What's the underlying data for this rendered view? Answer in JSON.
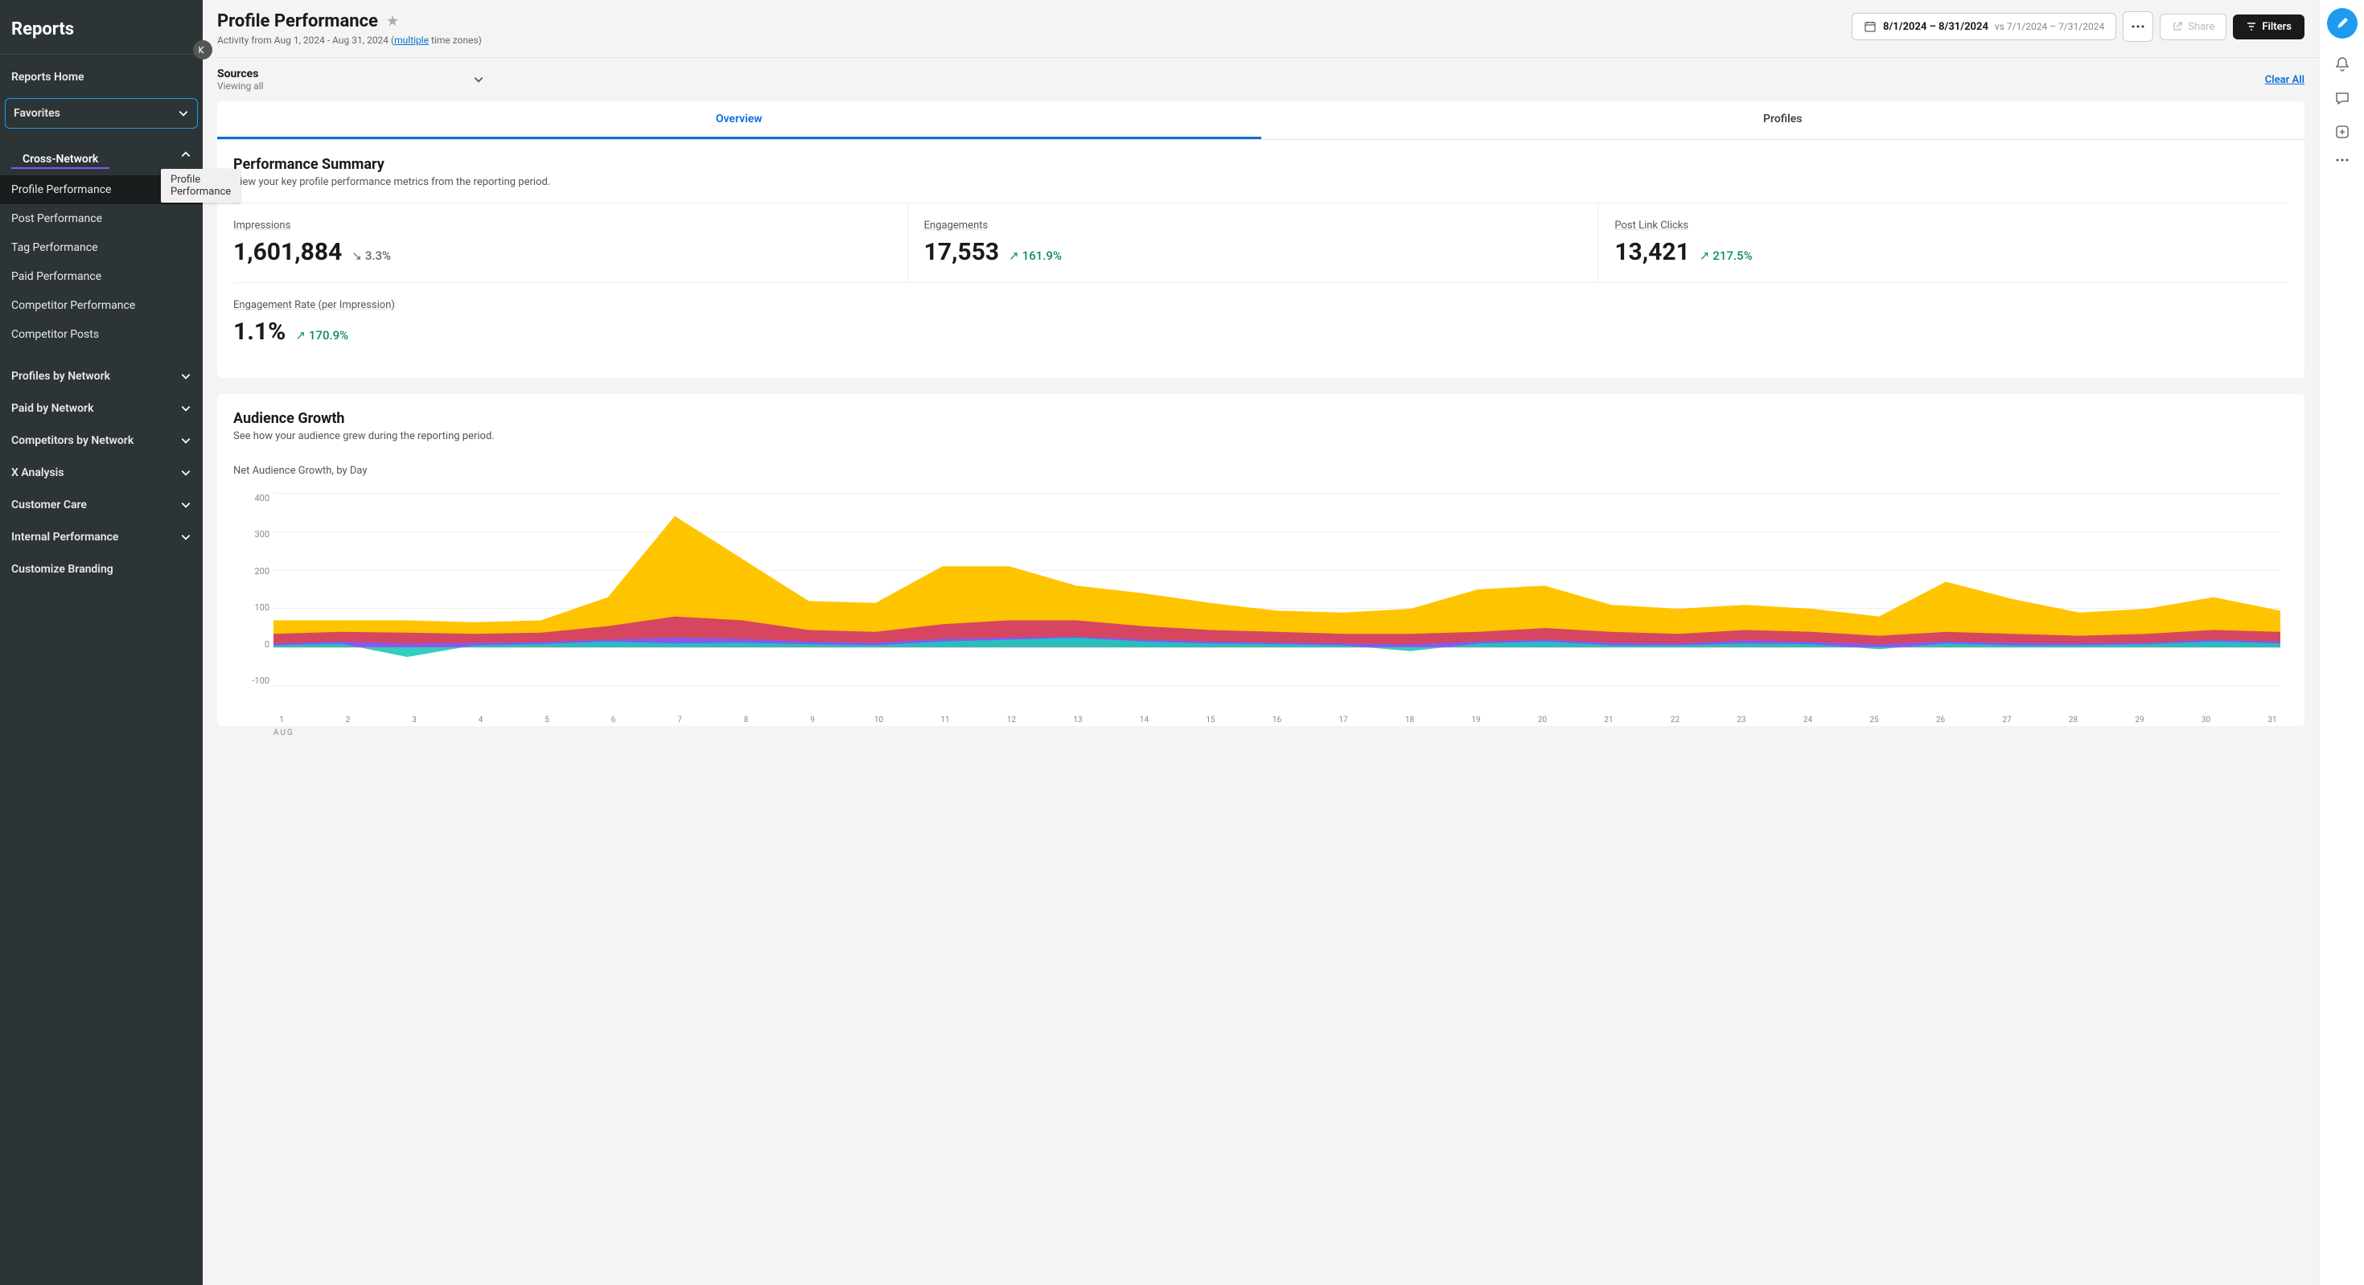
{
  "sidebar": {
    "title": "Reports",
    "home": "Reports Home",
    "favorites": "Favorites",
    "cross_network": "Cross-Network",
    "cn_items": [
      "Profile Performance",
      "Post Performance",
      "Tag Performance",
      "Paid Performance",
      "Competitor Performance",
      "Competitor Posts"
    ],
    "sections": [
      "Profiles by Network",
      "Paid by Network",
      "Competitors by Network",
      "X Analysis",
      "Customer Care",
      "Internal Performance"
    ],
    "customize": "Customize Branding",
    "tooltip": "Profile Performance"
  },
  "header": {
    "title": "Profile Performance",
    "subtitle_prefix": "Activity from Aug 1, 2024 - Aug 31, 2024 (",
    "subtitle_link": "multiple",
    "subtitle_suffix": " time zones)",
    "date_range": "8/1/2024 – 8/31/2024",
    "vs": "vs 7/1/2024 – 7/31/2024",
    "share": "Share",
    "filters": "Filters"
  },
  "sources": {
    "label": "Sources",
    "viewing": "Viewing all",
    "clear": "Clear All"
  },
  "tabs": {
    "overview": "Overview",
    "profiles": "Profiles"
  },
  "summary": {
    "title": "Performance Summary",
    "desc": "View your key profile performance metrics from the reporting period.",
    "metrics": [
      {
        "label": "Impressions",
        "value": "1,601,884",
        "delta": "3.3%",
        "dir": "down"
      },
      {
        "label": "Engagements",
        "value": "17,553",
        "delta": "161.9%",
        "dir": "up"
      },
      {
        "label": "Post Link Clicks",
        "value": "13,421",
        "delta": "217.5%",
        "dir": "up"
      }
    ],
    "metric2": {
      "label": "Engagement Rate (per Impression)",
      "value": "1.1%",
      "delta": "170.9%",
      "dir": "up"
    }
  },
  "growth": {
    "title": "Audience Growth",
    "desc": "See how your audience grew during the reporting period.",
    "chart_title": "Net Audience Growth, by Day",
    "month": "AUG"
  },
  "chart_data": {
    "type": "area",
    "title": "Net Audience Growth, by Day",
    "xlabel": "AUG",
    "ylabel": "",
    "ylim": [
      -100,
      400
    ],
    "yticks": [
      400,
      300,
      200,
      100,
      0,
      -100
    ],
    "categories": [
      1,
      2,
      3,
      4,
      5,
      6,
      7,
      8,
      9,
      10,
      11,
      12,
      13,
      14,
      15,
      16,
      17,
      18,
      19,
      20,
      21,
      22,
      23,
      24,
      25,
      26,
      27,
      28,
      29,
      30,
      31
    ],
    "series": [
      {
        "name": "yellow",
        "color": "#ffc400",
        "values": [
          70,
          70,
          70,
          65,
          70,
          130,
          340,
          230,
          120,
          115,
          210,
          210,
          160,
          140,
          115,
          95,
          90,
          100,
          150,
          160,
          110,
          100,
          110,
          100,
          80,
          170,
          125,
          90,
          100,
          130,
          95
        ]
      },
      {
        "name": "magenta",
        "color": "#d1386b",
        "values": [
          35,
          40,
          38,
          35,
          38,
          55,
          80,
          70,
          45,
          40,
          60,
          70,
          70,
          55,
          45,
          40,
          35,
          35,
          40,
          50,
          40,
          35,
          45,
          40,
          30,
          40,
          35,
          30,
          35,
          45,
          40
        ]
      },
      {
        "name": "teal",
        "color": "#1ec9b7",
        "values": [
          5,
          10,
          -25,
          5,
          8,
          15,
          10,
          12,
          8,
          5,
          15,
          20,
          25,
          15,
          10,
          8,
          5,
          -10,
          10,
          15,
          5,
          5,
          10,
          8,
          -5,
          10,
          5,
          5,
          8,
          15,
          10
        ]
      },
      {
        "name": "purple",
        "color": "#7b5cff",
        "values": [
          10,
          15,
          10,
          12,
          14,
          20,
          25,
          22,
          15,
          12,
          22,
          25,
          28,
          20,
          15,
          12,
          10,
          8,
          15,
          20,
          12,
          10,
          18,
          14,
          8,
          15,
          12,
          10,
          12,
          20,
          15
        ]
      }
    ]
  }
}
